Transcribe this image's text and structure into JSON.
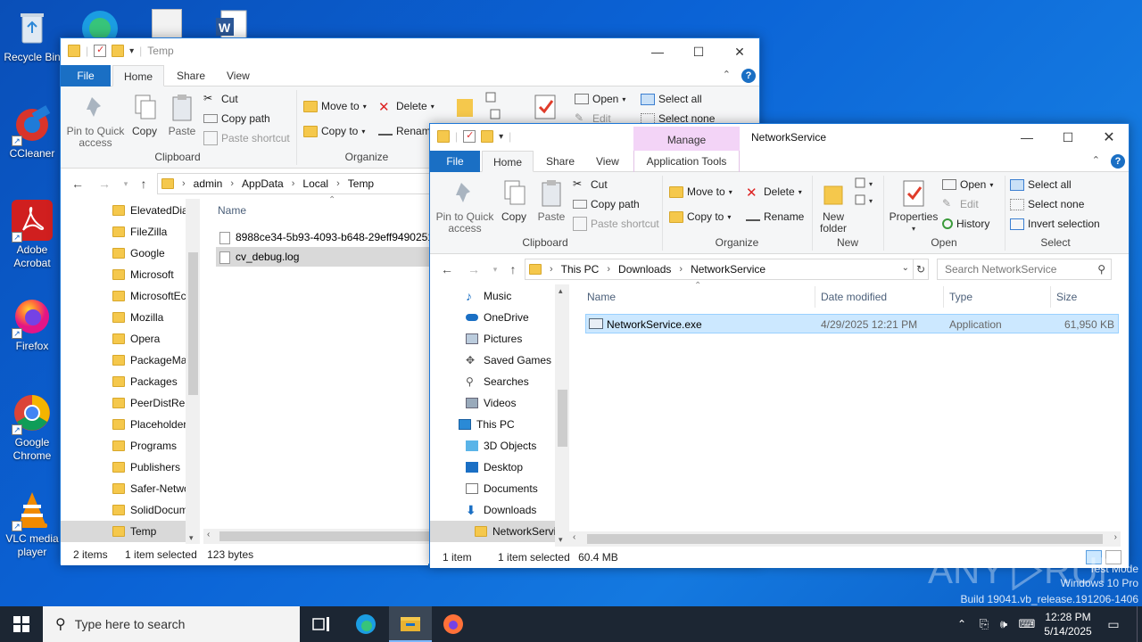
{
  "desktop": {
    "icons": [
      {
        "label": "Recycle Bin",
        "icon": "recycle-bin-icon"
      },
      {
        "label": "CCleaner",
        "icon": "ccleaner-icon"
      },
      {
        "label": "Adobe Acrobat",
        "icon": "acrobat-icon"
      },
      {
        "label": "Firefox",
        "icon": "firefox-icon"
      },
      {
        "label": "Google Chrome",
        "icon": "chrome-icon"
      },
      {
        "label": "VLC media player",
        "icon": "vlc-icon"
      }
    ],
    "watermark": {
      "mode": "Test Mode",
      "os": "Windows 10 Pro",
      "build": "Build 19041.vb_release.191206-1406",
      "brand": "ANY RUN"
    }
  },
  "temp_window": {
    "title": "Temp",
    "tabs": {
      "file": "File",
      "home": "Home",
      "share": "Share",
      "view": "View"
    },
    "ribbon": {
      "pin": "Pin to Quick access",
      "copy": "Copy",
      "paste": "Paste",
      "cut": "Cut",
      "copy_path": "Copy path",
      "paste_shortcut": "Paste shortcut",
      "clipboard": "Clipboard",
      "move_to": "Move to",
      "copy_to": "Copy to",
      "delete": "Delete",
      "rename": "Rename",
      "organize": "Organize",
      "open": "Open",
      "edit": "Edit",
      "select_all": "Select all",
      "select_none": "Select none"
    },
    "breadcrumb": [
      "admin",
      "AppData",
      "Local",
      "Temp"
    ],
    "nav_items": [
      "ElevatedDia",
      "FileZilla",
      "Google",
      "Microsoft",
      "MicrosoftEc",
      "Mozilla",
      "Opera",
      "PackageMa",
      "Packages",
      "PeerDistRep",
      "Placeholder",
      "Programs",
      "Publishers",
      "Safer-Netwo",
      "SolidDocum",
      "Temp"
    ],
    "column_name": "Name",
    "files": [
      "8988ce34-5b93-4093-b648-29eff9490251.",
      "cv_debug.log"
    ],
    "status": {
      "items": "2 items",
      "selected": "1 item selected",
      "size": "123 bytes"
    }
  },
  "ns_window": {
    "title": "NetworkService",
    "manage_tab": "Manage",
    "tabs": {
      "file": "File",
      "home": "Home",
      "share": "Share",
      "view": "View",
      "app_tools": "Application Tools"
    },
    "ribbon": {
      "pin": "Pin to Quick access",
      "copy": "Copy",
      "paste": "Paste",
      "cut": "Cut",
      "copy_path": "Copy path",
      "paste_shortcut": "Paste shortcut",
      "clipboard": "Clipboard",
      "move_to": "Move to",
      "copy_to": "Copy to",
      "delete": "Delete",
      "rename": "Rename",
      "organize": "Organize",
      "new_folder": "New folder",
      "new": "New",
      "properties": "Properties",
      "open": "Open",
      "edit": "Edit",
      "history": "History",
      "open_group": "Open",
      "select_all": "Select all",
      "select_none": "Select none",
      "invert_selection": "Invert selection",
      "select_group": "Select"
    },
    "breadcrumb": [
      "This PC",
      "Downloads",
      "NetworkService"
    ],
    "search_placeholder": "Search NetworkService",
    "nav_items": [
      {
        "label": "Music",
        "icon": "music-icon"
      },
      {
        "label": "OneDrive",
        "icon": "onedrive-icon"
      },
      {
        "label": "Pictures",
        "icon": "pictures-icon"
      },
      {
        "label": "Saved Games",
        "icon": "saved-games-icon"
      },
      {
        "label": "Searches",
        "icon": "searches-icon"
      },
      {
        "label": "Videos",
        "icon": "videos-icon"
      },
      {
        "label": "This PC",
        "icon": "this-pc-icon"
      },
      {
        "label": "3D Objects",
        "icon": "3d-objects-icon"
      },
      {
        "label": "Desktop",
        "icon": "desktop-icon"
      },
      {
        "label": "Documents",
        "icon": "documents-icon"
      },
      {
        "label": "Downloads",
        "icon": "downloads-icon"
      },
      {
        "label": "NetworkServi",
        "icon": "folder-icon"
      }
    ],
    "columns": {
      "name": "Name",
      "date": "Date modified",
      "type": "Type",
      "size": "Size"
    },
    "files": [
      {
        "name": "NetworkService.exe",
        "date": "4/29/2025 12:21 PM",
        "type": "Application",
        "size": "61,950 KB"
      }
    ],
    "status": {
      "items": "1 item",
      "selected": "1 item selected",
      "size": "60.4 MB"
    }
  },
  "taskbar": {
    "search_placeholder": "Type here to search",
    "time": "12:28 PM",
    "date": "5/14/2025"
  },
  "colors": {
    "accent": "#1a6fc4",
    "manage_tab": "#f3d4f7",
    "selection": "#cce8ff"
  }
}
